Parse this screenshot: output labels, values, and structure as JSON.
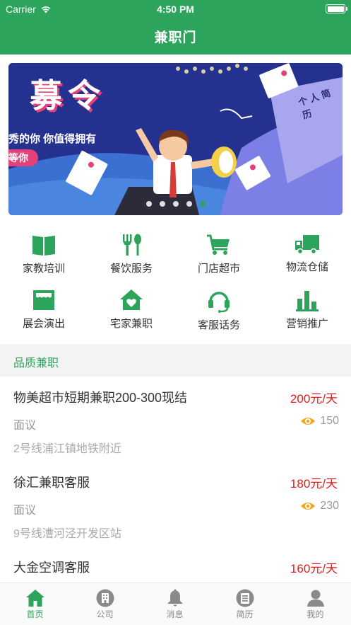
{
  "status_bar": {
    "carrier": "Carrier",
    "time": "4:50 PM"
  },
  "nav": {
    "title": "兼职门"
  },
  "banner": {
    "headline": "募令",
    "subline": "秀的你 你值得拥有",
    "tag": "等你",
    "resume_text": "个人简历",
    "slide_count": 5,
    "active_slide": 4
  },
  "categories": [
    {
      "label": "家教培训",
      "icon": "book-icon"
    },
    {
      "label": "餐饮服务",
      "icon": "fork-spoon-icon"
    },
    {
      "label": "门店超市",
      "icon": "shopping-cart-icon"
    },
    {
      "label": "物流仓储",
      "icon": "truck-icon"
    },
    {
      "label": "展会演出",
      "icon": "stage-icon"
    },
    {
      "label": "宅家兼职",
      "icon": "home-heart-icon"
    },
    {
      "label": "客服话务",
      "icon": "headset-icon"
    },
    {
      "label": "营销推广",
      "icon": "bar-chart-icon"
    }
  ],
  "section": {
    "title": "品质兼职"
  },
  "jobs": [
    {
      "title": "物美超市短期兼职200-300现结",
      "pay": "200元/天",
      "salary": "面议",
      "views": "150",
      "location": "2号线浦江镇地铁附近"
    },
    {
      "title": "徐汇兼职客服",
      "pay": "180元/天",
      "salary": "面议",
      "views": "230",
      "location": "9号线漕河泾开发区站"
    },
    {
      "title": "大金空调客服",
      "pay": "160元/天"
    }
  ],
  "tabs": [
    {
      "label": "首页",
      "icon": "home-icon",
      "active": true
    },
    {
      "label": "公司",
      "icon": "company-icon",
      "active": false
    },
    {
      "label": "消息",
      "icon": "bell-icon",
      "active": false
    },
    {
      "label": "简历",
      "icon": "resume-icon",
      "active": false
    },
    {
      "label": "我的",
      "icon": "user-icon",
      "active": false
    }
  ],
  "colors": {
    "brand": "#2ca45b",
    "price": "#e01b1b",
    "eye": "#f2a61e",
    "muted": "#999999"
  }
}
